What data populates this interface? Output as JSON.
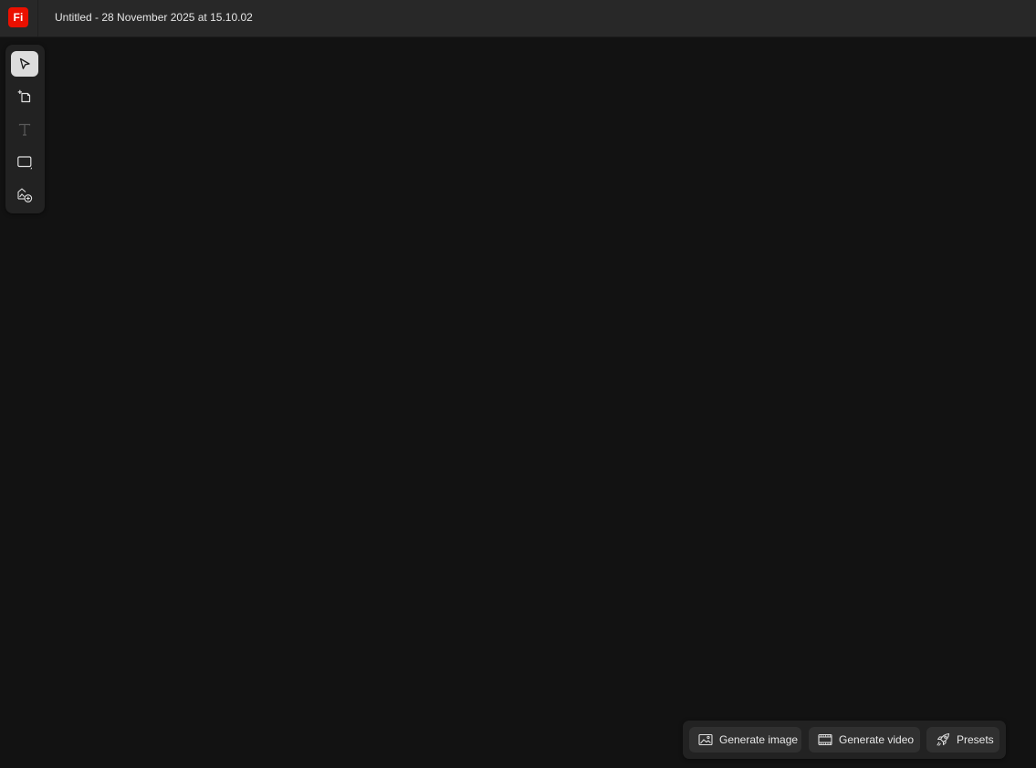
{
  "app": {
    "logo_text": "Fi",
    "brand_color": "#eb1000",
    "document_title": "Untitled - 28 November 2025 at 15.10.02"
  },
  "toolbar": {
    "tools": [
      {
        "name": "select",
        "icon": "cursor-arrow-icon",
        "active": true
      },
      {
        "name": "artboard",
        "icon": "add-frame-icon",
        "active": false
      },
      {
        "name": "text",
        "icon": "text-t-icon",
        "active": false,
        "disabled": true
      },
      {
        "name": "shape",
        "icon": "rectangle-icon",
        "active": false
      },
      {
        "name": "add-image",
        "icon": "image-add-icon",
        "active": false
      }
    ]
  },
  "actions": {
    "generate_image_label": "Generate image",
    "generate_video_label": "Generate video",
    "presets_label": "Presets"
  }
}
